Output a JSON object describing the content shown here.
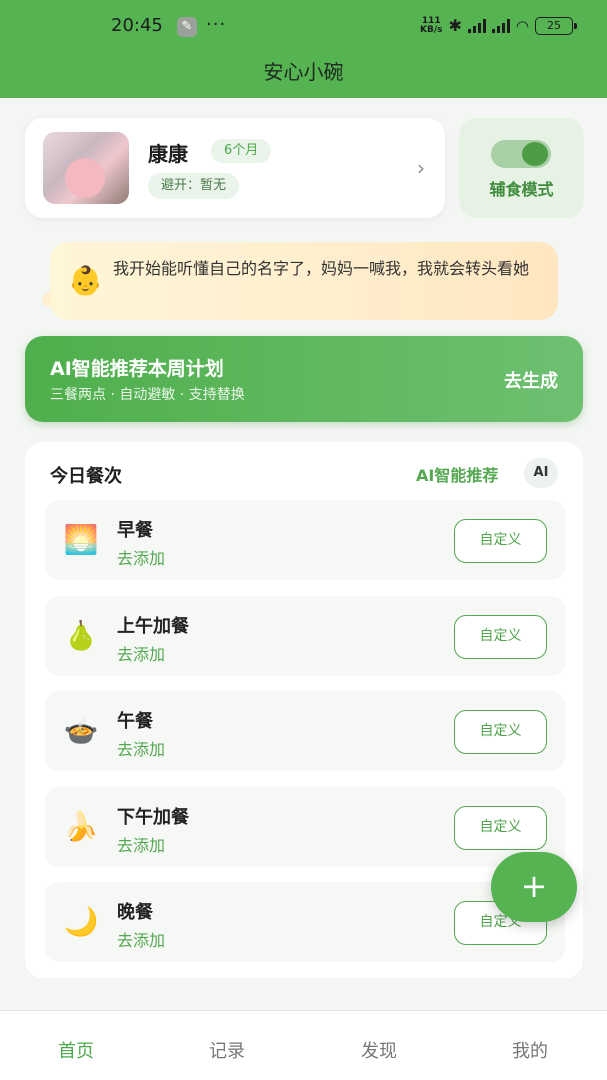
{
  "status_bar": {
    "time": "20:45",
    "speed_top": "111",
    "speed_unit": "KB/s",
    "battery": "25"
  },
  "app": {
    "title": "安心小碗"
  },
  "baby": {
    "name": "康康",
    "age": "6个月",
    "allergy": "避开：暂无"
  },
  "mode": {
    "label": "辅食模式",
    "enabled": true
  },
  "tip": {
    "text": "我开始能听懂自己的名字了，妈妈一喊我，我就会转头看她",
    "emoji": "👶"
  },
  "ai_banner": {
    "title": "AI智能推荐本周计划",
    "subtitle": "三餐两点 · 自动避敏 · 支持替换",
    "action": "去生成"
  },
  "meals": {
    "title": "今日餐次",
    "ai_recommend": "AI智能推荐",
    "ai_chip": "AI",
    "items": [
      {
        "name": "早餐",
        "status": "去添加",
        "button": "自定义",
        "icon": "🌅",
        "icon_name": "sunrise-icon"
      },
      {
        "name": "上午加餐",
        "status": "去添加",
        "button": "自定义",
        "icon": "🍐",
        "icon_name": "pear-icon"
      },
      {
        "name": "午餐",
        "status": "去添加",
        "button": "自定义",
        "icon": "🍲",
        "icon_name": "pot-icon"
      },
      {
        "name": "下午加餐",
        "status": "去添加",
        "button": "自定义",
        "icon": "🍌",
        "icon_name": "banana-icon"
      },
      {
        "name": "晚餐",
        "status": "去添加",
        "button": "自定义",
        "icon": "🌙",
        "icon_name": "moon-icon"
      }
    ]
  },
  "fab": {
    "label": "+"
  },
  "tabs": [
    {
      "label": "首页",
      "active": true
    },
    {
      "label": "记录",
      "active": false
    },
    {
      "label": "发现",
      "active": false
    },
    {
      "label": "我的",
      "active": false
    }
  ],
  "colors": {
    "primary": "#55b352",
    "banner": "#4faf4c",
    "tip_bg": "#ffefcf"
  }
}
